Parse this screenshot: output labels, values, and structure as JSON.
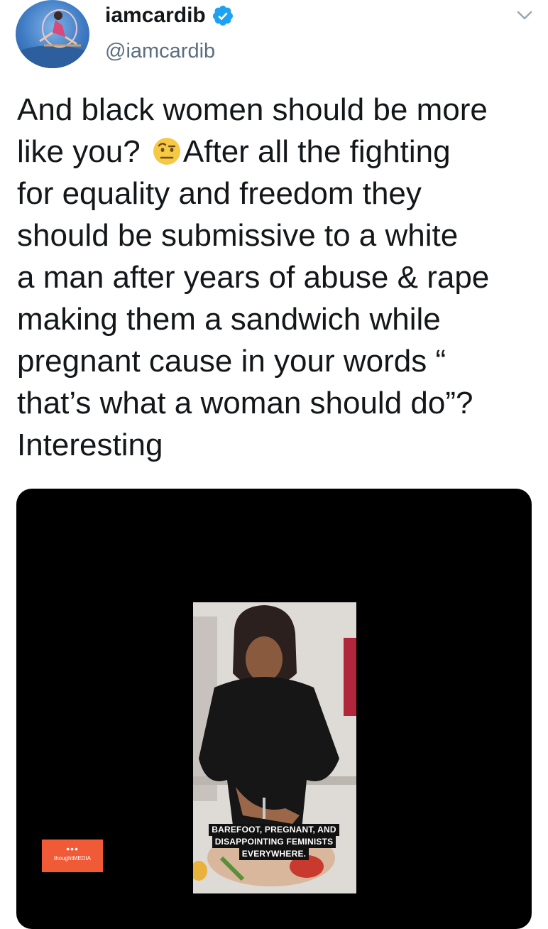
{
  "tweet": {
    "display_name": "iamcardib",
    "verified": true,
    "handle": "@iamcardib",
    "text_before_emoji": "And black women should be more\nlike you? ",
    "emoji": "face-with-raised-eyebrow",
    "text_after_emoji": "After all the fighting\nfor equality and freedom they\nshould be submissive to a white\na man after years of abuse & rape\nmaking them a sandwich while\npregnant cause in your words “\nthat’s what a woman should do”?\nInteresting"
  },
  "media": {
    "caption_lines": [
      "BAREFOOT, PREGNANT, AND",
      "DISAPPOINTING FEMINISTS",
      "EVERYWHERE."
    ],
    "watermark_dots": "•••",
    "watermark_text": "thoughtMEDIA"
  },
  "colors": {
    "verified_badge": "#1da1f2",
    "handle_text": "#5b6f80",
    "watermark_bg": "#f05a36",
    "media_bg": "#000000"
  },
  "icons": {
    "verified": "verified-badge-icon",
    "menu": "chevron-down-icon"
  }
}
